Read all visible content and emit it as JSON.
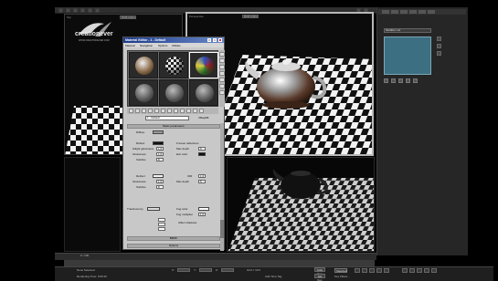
{
  "app": {
    "logo": {
      "brand": "creation",
      "brand_suffix": "ever",
      "url": "WWW.CREATIONEVER.COM"
    }
  },
  "viewports": [
    {
      "id": "top-left",
      "label": "Top",
      "dropdown": "RGB Alpha"
    },
    {
      "id": "top-right",
      "label": "Perspective",
      "dropdown": "RGB Alpha"
    },
    {
      "id": "bottom-right",
      "label": "Perspective"
    }
  ],
  "command_panel": {
    "modifier_list": "Modifier List",
    "stack_color": "#3d6f82"
  },
  "material_editor": {
    "title": "Material Editor - 1 - Default",
    "menu": [
      "Material",
      "Navigation",
      "Options",
      "Utilities"
    ],
    "material_name": "1 - Default",
    "material_type": "VRayMtl",
    "rollouts": {
      "basic": "Basic parameters",
      "brdf": "BRDF",
      "options": "Options"
    },
    "params": {
      "diffuse": "Diffuse",
      "reflect": "Reflect",
      "glossiness": "Glossiness",
      "subdivs": "Subdivs",
      "hilight": "Hilight glossiness",
      "fresnel": "Fresnel reflections",
      "fresnel_ior": "Fresnel IOR",
      "max_depth": "Max depth",
      "exit_color": "Exit color",
      "refract": "Refract",
      "ior": "IOR",
      "use_interp": "Use interpolation",
      "translucent": "Translucency",
      "fog_color": "Fog color",
      "fog_mult": "Fog multiplier",
      "affect_shadows": "Affect shadows",
      "thickness": "Thickness"
    },
    "values": {
      "gloss": "1.0",
      "subdivs": "8",
      "max_depth": "5",
      "ior": "1.6",
      "fog_mult": "1.0"
    }
  },
  "timeline": {
    "frame": "0 / 100"
  },
  "status": {
    "selection": "None Selected",
    "render_time": "Rendering Time: 0:00:15",
    "add_time_tag": "Add Time Tag",
    "auto_key": "Auto Key",
    "selected_dd": "Selected",
    "set_key": "Set Key",
    "key_filters": "Key Filters...",
    "coords_x": "X:",
    "coords_y": "Y:",
    "coords_z": "Z:",
    "grid": "Grid = 10.0"
  }
}
